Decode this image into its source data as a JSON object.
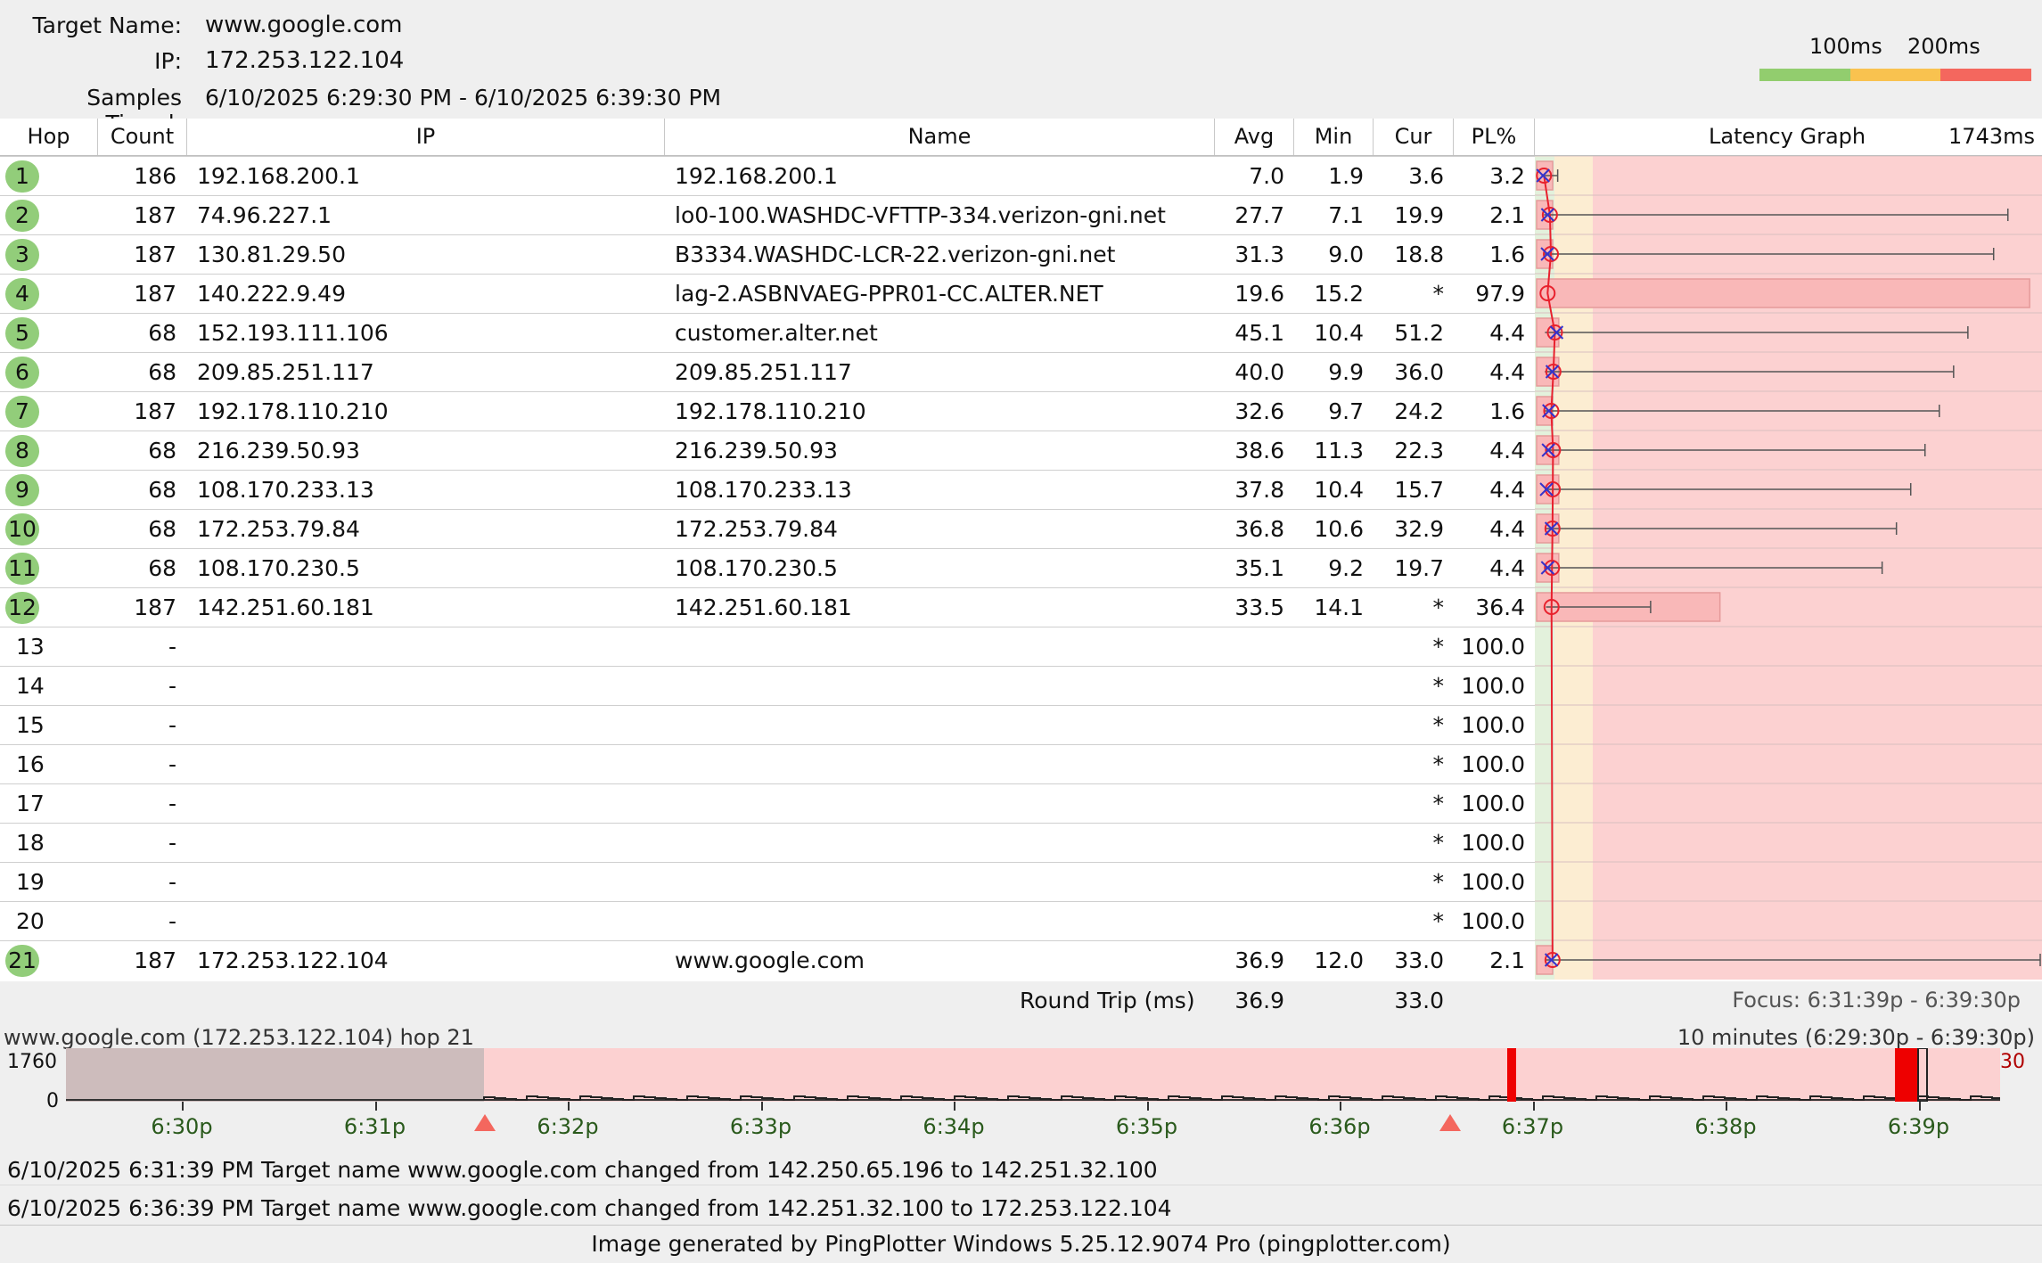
{
  "header": {
    "target_label": "Target Name:",
    "target_value": "www.google.com",
    "ip_label": "IP:",
    "ip_value": "172.253.122.104",
    "samples_label": "Samples Timed:",
    "samples_value": "6/10/2025 6:29:30 PM - 6/10/2025 6:39:30 PM"
  },
  "scale": {
    "label_100": "100ms",
    "label_200": "200ms",
    "color_good": "#92cd6e",
    "color_warn": "#f9c24f",
    "color_bad": "#f4675e"
  },
  "columns": {
    "hop": "Hop",
    "count": "Count",
    "ip": "IP",
    "name": "Name",
    "avg": "Avg",
    "min": "Min",
    "cur": "Cur",
    "pl": "PL%",
    "graph": "Latency Graph",
    "graph_max": "1743ms"
  },
  "hops": [
    {
      "hop": "1",
      "count": "186",
      "ip": "192.168.200.1",
      "name": "192.168.200.1",
      "avg": "7.0",
      "min": "1.9",
      "cur": "3.6",
      "pl": "3.2",
      "badge": true,
      "avg_ms": 7.0,
      "min_ms": 1.9,
      "cur_ms": 3.6,
      "max_ms": 55,
      "pl_pct": 3.2
    },
    {
      "hop": "2",
      "count": "187",
      "ip": "74.96.227.1",
      "name": "lo0-100.WASHDC-VFTTP-334.verizon-gni.net",
      "avg": "27.7",
      "min": "7.1",
      "cur": "19.9",
      "pl": "2.1",
      "badge": true,
      "avg_ms": 27.7,
      "min_ms": 7.1,
      "cur_ms": 19.9,
      "max_ms": 1630,
      "pl_pct": 2.1
    },
    {
      "hop": "3",
      "count": "187",
      "ip": "130.81.29.50",
      "name": "B3334.WASHDC-LCR-22.verizon-gni.net",
      "avg": "31.3",
      "min": "9.0",
      "cur": "18.8",
      "pl": "1.6",
      "badge": true,
      "avg_ms": 31.3,
      "min_ms": 9.0,
      "cur_ms": 18.8,
      "max_ms": 1580,
      "pl_pct": 1.6
    },
    {
      "hop": "4",
      "count": "187",
      "ip": "140.222.9.49",
      "name": "lag-2.ASBNVAEG-PPR01-CC.ALTER.NET",
      "avg": "19.6",
      "min": "15.2",
      "cur": "*",
      "pl": "97.9",
      "badge": true,
      "avg_ms": 19.6,
      "min_ms": 15.2,
      "cur_ms": null,
      "max_ms": null,
      "pl_pct": 97.9
    },
    {
      "hop": "5",
      "count": "68",
      "ip": "152.193.111.106",
      "name": "customer.alter.net",
      "avg": "45.1",
      "min": "10.4",
      "cur": "51.2",
      "pl": "4.4",
      "badge": true,
      "avg_ms": 45.1,
      "min_ms": 10.4,
      "cur_ms": 51.2,
      "max_ms": 1490,
      "pl_pct": 4.4
    },
    {
      "hop": "6",
      "count": "68",
      "ip": "209.85.251.117",
      "name": "209.85.251.117",
      "avg": "40.0",
      "min": "9.9",
      "cur": "36.0",
      "pl": "4.4",
      "badge": true,
      "avg_ms": 40.0,
      "min_ms": 9.9,
      "cur_ms": 36.0,
      "max_ms": 1440,
      "pl_pct": 4.4
    },
    {
      "hop": "7",
      "count": "187",
      "ip": "192.178.110.210",
      "name": "192.178.110.210",
      "avg": "32.6",
      "min": "9.7",
      "cur": "24.2",
      "pl": "1.6",
      "badge": true,
      "avg_ms": 32.6,
      "min_ms": 9.7,
      "cur_ms": 24.2,
      "max_ms": 1390,
      "pl_pct": 1.6
    },
    {
      "hop": "8",
      "count": "68",
      "ip": "216.239.50.93",
      "name": "216.239.50.93",
      "avg": "38.6",
      "min": "11.3",
      "cur": "22.3",
      "pl": "4.4",
      "badge": true,
      "avg_ms": 38.6,
      "min_ms": 11.3,
      "cur_ms": 22.3,
      "max_ms": 1340,
      "pl_pct": 4.4
    },
    {
      "hop": "9",
      "count": "68",
      "ip": "108.170.233.13",
      "name": "108.170.233.13",
      "avg": "37.8",
      "min": "10.4",
      "cur": "15.7",
      "pl": "4.4",
      "badge": true,
      "avg_ms": 37.8,
      "min_ms": 10.4,
      "cur_ms": 15.7,
      "max_ms": 1290,
      "pl_pct": 4.4
    },
    {
      "hop": "10",
      "count": "68",
      "ip": "172.253.79.84",
      "name": "172.253.79.84",
      "avg": "36.8",
      "min": "10.6",
      "cur": "32.9",
      "pl": "4.4",
      "badge": true,
      "avg_ms": 36.8,
      "min_ms": 10.6,
      "cur_ms": 32.9,
      "max_ms": 1240,
      "pl_pct": 4.4
    },
    {
      "hop": "11",
      "count": "68",
      "ip": "108.170.230.5",
      "name": "108.170.230.5",
      "avg": "35.1",
      "min": "9.2",
      "cur": "19.7",
      "pl": "4.4",
      "badge": true,
      "avg_ms": 35.1,
      "min_ms": 9.2,
      "cur_ms": 19.7,
      "max_ms": 1190,
      "pl_pct": 4.4
    },
    {
      "hop": "12",
      "count": "187",
      "ip": "142.251.60.181",
      "name": "142.251.60.181",
      "avg": "33.5",
      "min": "14.1",
      "cur": "*",
      "pl": "36.4",
      "badge": true,
      "avg_ms": 33.5,
      "min_ms": 14.1,
      "cur_ms": null,
      "max_ms": 380,
      "pl_pct": 36.4
    },
    {
      "hop": "13",
      "count": "-",
      "ip": "",
      "name": "",
      "avg": "",
      "min": "",
      "cur": "*",
      "pl": "100.0",
      "badge": false
    },
    {
      "hop": "14",
      "count": "-",
      "ip": "",
      "name": "",
      "avg": "",
      "min": "",
      "cur": "*",
      "pl": "100.0",
      "badge": false
    },
    {
      "hop": "15",
      "count": "-",
      "ip": "",
      "name": "",
      "avg": "",
      "min": "",
      "cur": "*",
      "pl": "100.0",
      "badge": false
    },
    {
      "hop": "16",
      "count": "-",
      "ip": "",
      "name": "",
      "avg": "",
      "min": "",
      "cur": "*",
      "pl": "100.0",
      "badge": false
    },
    {
      "hop": "17",
      "count": "-",
      "ip": "",
      "name": "",
      "avg": "",
      "min": "",
      "cur": "*",
      "pl": "100.0",
      "badge": false
    },
    {
      "hop": "18",
      "count": "-",
      "ip": "",
      "name": "",
      "avg": "",
      "min": "",
      "cur": "*",
      "pl": "100.0",
      "badge": false
    },
    {
      "hop": "19",
      "count": "-",
      "ip": "",
      "name": "",
      "avg": "",
      "min": "",
      "cur": "*",
      "pl": "100.0",
      "badge": false
    },
    {
      "hop": "20",
      "count": "-",
      "ip": "",
      "name": "",
      "avg": "",
      "min": "",
      "cur": "*",
      "pl": "100.0",
      "badge": false
    },
    {
      "hop": "21",
      "count": "187",
      "ip": "172.253.122.104",
      "name": "www.google.com",
      "avg": "36.9",
      "min": "12.0",
      "cur": "33.0",
      "pl": "2.1",
      "badge": true,
      "avg_ms": 36.9,
      "min_ms": 12.0,
      "cur_ms": 33.0,
      "max_ms": 1743,
      "pl_pct": 2.1
    }
  ],
  "roundtrip": {
    "label": "Round Trip (ms)",
    "avg": "36.9",
    "cur": "33.0",
    "focus": "Focus: 6:31:39p - 6:39:30p"
  },
  "timeline": {
    "title": "www.google.com (172.253.122.104) hop 21",
    "range": "10 minutes (6:29:30p - 6:39:30p)",
    "y_max": "1760",
    "y_min": "0",
    "pl_max": "30",
    "ticks": [
      "6:30p",
      "6:31p",
      "6:32p",
      "6:33p",
      "6:34p",
      "6:35p",
      "6:36p",
      "6:37p",
      "6:38p",
      "6:39p"
    ]
  },
  "events": [
    "6/10/2025 6:31:39 PM Target name www.google.com changed from 142.250.65.196 to 142.251.32.100",
    "6/10/2025 6:36:39 PM Target name www.google.com changed from 142.251.32.100 to 172.253.122.104"
  ],
  "footer": "Image generated by PingPlotter Windows 5.25.12.9074 Pro (pingplotter.com)"
}
